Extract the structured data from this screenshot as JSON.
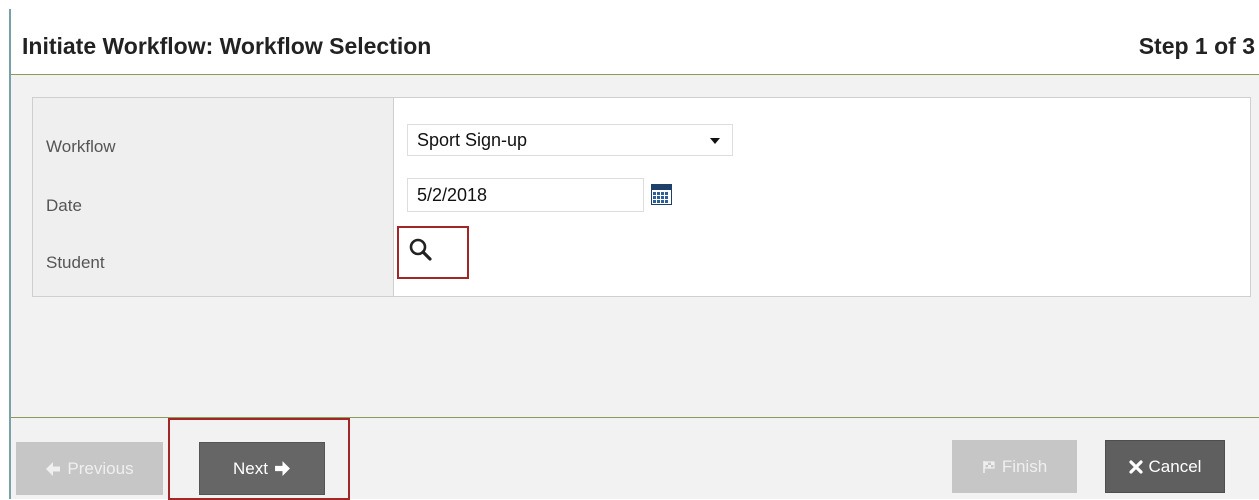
{
  "dialog": {
    "title": "Initiate Workflow: Workflow Selection",
    "step": "Step 1 of 3"
  },
  "form": {
    "workflow": {
      "label": "Workflow",
      "value": "Sport Sign-up"
    },
    "date": {
      "label": "Date",
      "value": "5/2/2018"
    },
    "student": {
      "label": "Student"
    }
  },
  "buttons": {
    "previous": "Previous",
    "next": "Next",
    "finish": "Finish",
    "cancel": "Cancel"
  },
  "icons": {
    "dropdown": "chevron-down-icon",
    "calendar": "calendar-icon",
    "search": "search-icon",
    "previous": "arrow-left-icon",
    "next": "arrow-right-icon",
    "finish": "flag-icon",
    "cancel": "close-icon"
  },
  "colors": {
    "highlight": "#a32626",
    "primary_button": "#666666",
    "disabled_button": "#c6c6c6",
    "divider": "#8c9a5b"
  }
}
